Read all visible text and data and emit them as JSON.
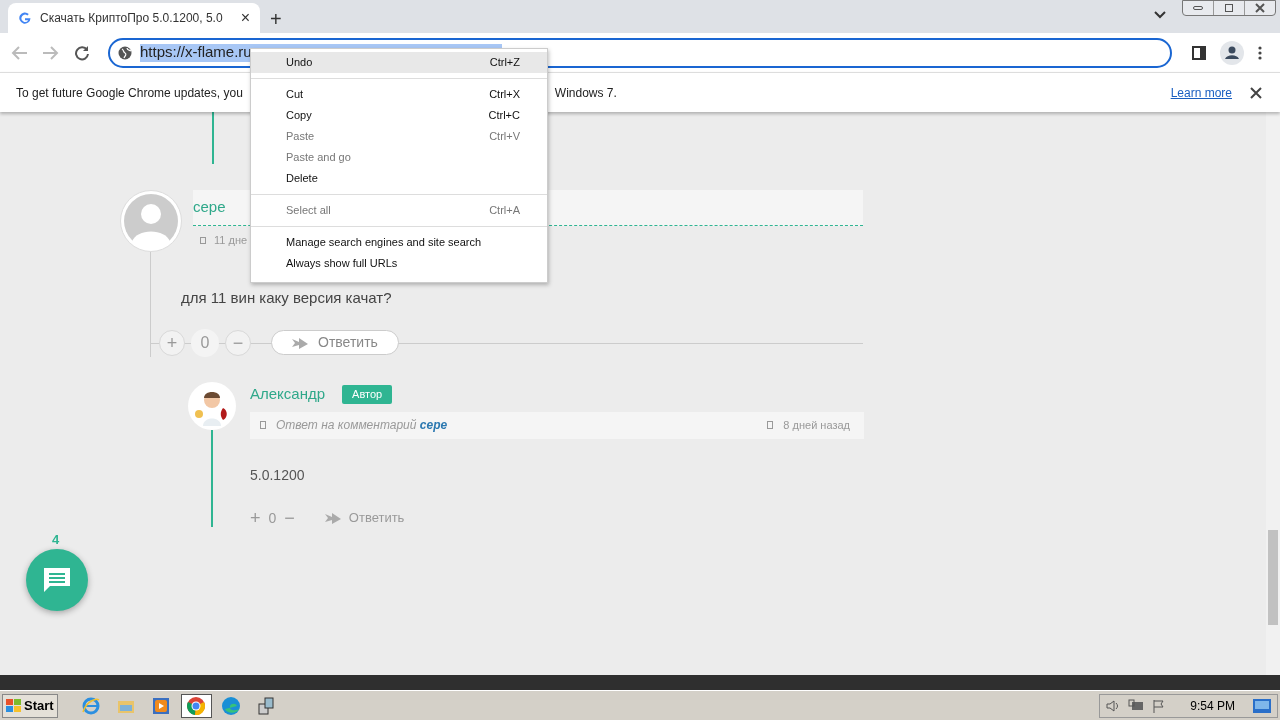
{
  "tab": {
    "title": "Скачать КриптоПро 5.0.1200, 5.0",
    "close": "×",
    "new_tab": "+"
  },
  "address_bar": {
    "url": "https://x-flame.ru"
  },
  "infobar": {
    "text_start": "To get future Google Chrome updates, you",
    "text_end": "Windows 7.",
    "link": "Learn more"
  },
  "context_menu": [
    [
      {
        "label": "Undo",
        "shortcut": "Ctrl+Z",
        "disabled": false,
        "selected": true
      }
    ],
    [
      {
        "label": "Cut",
        "shortcut": "Ctrl+X",
        "disabled": false,
        "selected": false
      },
      {
        "label": "Copy",
        "shortcut": "Ctrl+C",
        "disabled": false,
        "selected": false
      },
      {
        "label": "Paste",
        "shortcut": "Ctrl+V",
        "disabled": true,
        "selected": false
      },
      {
        "label": "Paste and go",
        "disabled": true,
        "selected": false
      },
      {
        "label": "Delete",
        "disabled": false,
        "selected": false
      }
    ],
    [
      {
        "label": "Select all",
        "shortcut": "Ctrl+A",
        "disabled": true,
        "selected": false
      }
    ],
    [
      {
        "label": "Manage search engines and site search",
        "disabled": false,
        "selected": false
      },
      {
        "label": "Always show full URLs",
        "disabled": false,
        "selected": false
      }
    ]
  ],
  "comment": {
    "author": "сере",
    "date": "11 дне",
    "text": "для 11 вин каку версия качат?",
    "votes": "0",
    "plus": "+",
    "minus": "−",
    "reply": "Ответить"
  },
  "reply": {
    "author": "Александр",
    "badge": "Автор",
    "reply_to_label": "Ответ на комментарий",
    "reply_to": "сере",
    "date": "8 дней назад",
    "text": "5.0.1200",
    "plus": "+",
    "votes": "0",
    "minus": "−",
    "reply": "Ответить"
  },
  "chat_button": {
    "count": "4"
  },
  "taskbar": {
    "start": "Start",
    "apps": [
      {
        "kind": "ie",
        "selected": false
      },
      {
        "kind": "folder",
        "selected": false
      },
      {
        "kind": "media",
        "selected": false
      },
      {
        "kind": "chrome",
        "selected": true
      },
      {
        "kind": "edge",
        "selected": false
      },
      {
        "kind": "installer",
        "selected": false
      }
    ],
    "clock": "9:54 PM"
  }
}
